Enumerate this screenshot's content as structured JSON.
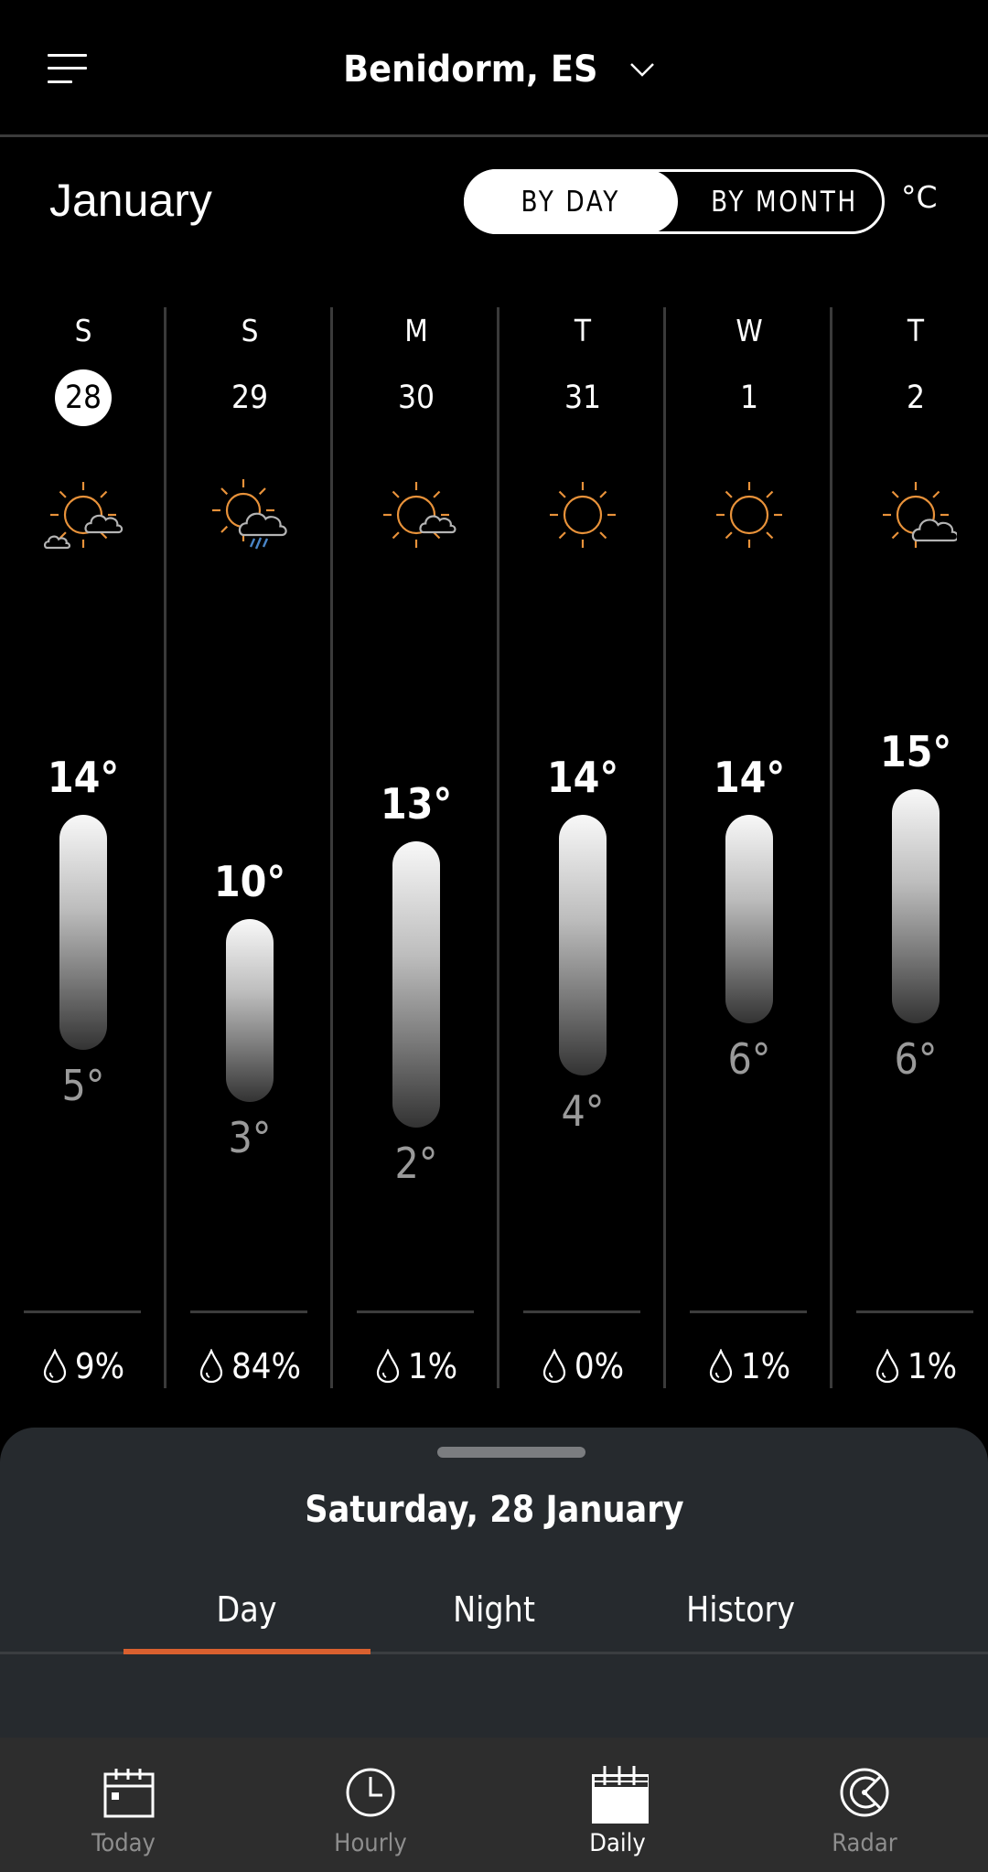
{
  "header": {
    "location": "Benidorm, ES",
    "menu_icon": "menu-icon",
    "dropdown_icon": "chevron-down-icon"
  },
  "month_row": {
    "month": "January",
    "toggle": {
      "options": [
        "BY DAY",
        "BY MONTH"
      ],
      "selected": "BY DAY"
    },
    "unit": "°C"
  },
  "forecast": {
    "days": [
      {
        "dow": "S",
        "date": "28",
        "selected": true,
        "icon": "partly-cloudy-icon",
        "high": "14°",
        "low": "5°",
        "high_value": 14,
        "low_value": 5,
        "precip": "9%"
      },
      {
        "dow": "S",
        "date": "29",
        "selected": false,
        "icon": "rain-partly-cloudy-icon",
        "high": "10°",
        "low": "3°",
        "high_value": 10,
        "low_value": 3,
        "precip": "84%"
      },
      {
        "dow": "M",
        "date": "30",
        "selected": false,
        "icon": "mostly-sunny-icon",
        "high": "13°",
        "low": "2°",
        "high_value": 13,
        "low_value": 2,
        "precip": "1%"
      },
      {
        "dow": "T",
        "date": "31",
        "selected": false,
        "icon": "sunny-icon",
        "high": "14°",
        "low": "4°",
        "high_value": 14,
        "low_value": 4,
        "precip": "0%"
      },
      {
        "dow": "W",
        "date": "1",
        "selected": false,
        "icon": "sunny-icon",
        "high": "14°",
        "low": "6°",
        "high_value": 14,
        "low_value": 6,
        "precip": "1%"
      },
      {
        "dow": "T",
        "date": "2",
        "selected": false,
        "icon": "partly-cloudy-icon",
        "high": "15°",
        "low": "6°",
        "high_value": 15,
        "low_value": 6,
        "precip": "1%"
      }
    ]
  },
  "sheet": {
    "title": "Saturday, 28 January",
    "tabs": [
      "Day",
      "Night",
      "History"
    ],
    "active_tab": "Day"
  },
  "nav": {
    "items": [
      {
        "label": "Today",
        "icon": "calendar-today-icon",
        "active": false
      },
      {
        "label": "Hourly",
        "icon": "clock-icon",
        "active": false
      },
      {
        "label": "Daily",
        "icon": "calendar-daily-icon",
        "active": true
      },
      {
        "label": "Radar",
        "icon": "radar-icon",
        "active": false
      }
    ]
  },
  "colors": {
    "accent": "#d9602f",
    "sun": "#e8923a",
    "cloud": "#b4b4b4",
    "rain": "#4a86c8",
    "sheet_bg": "#262a2e",
    "nav_bg": "#2d2d2d"
  }
}
